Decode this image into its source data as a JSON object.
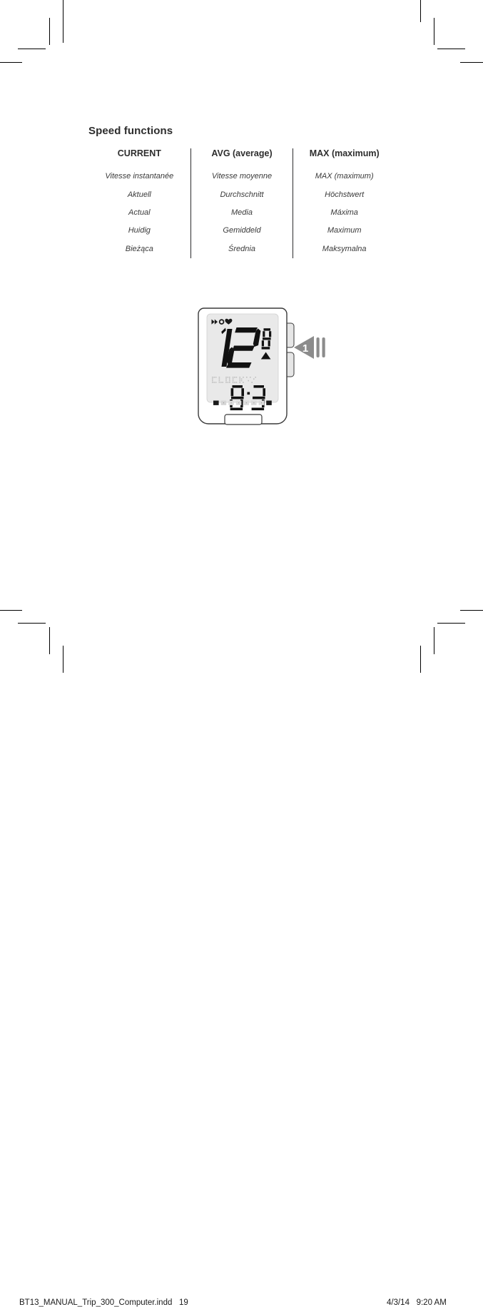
{
  "page": {
    "title": "Speed functions"
  },
  "table": {
    "columns": [
      {
        "header": "CURRENT",
        "items": [
          "Vitesse instantanée",
          "Aktuell",
          "Actual",
          "Huidig",
          "Bieżąca"
        ]
      },
      {
        "header": "AVG (average)",
        "items": [
          "Vitesse moyenne",
          "Durchschnitt",
          "Media",
          "Gemiddeld",
          "Średnia"
        ]
      },
      {
        "header": "MAX (maximum)",
        "items": [
          "MAX (maximum)",
          "Höchstwert",
          "Máxima",
          "Maximum",
          "Maksymalna"
        ]
      }
    ]
  },
  "device": {
    "name": "bike-computer",
    "icons": [
      "chevron-double-right-icon",
      "circle-icon",
      "heart-icon"
    ],
    "speed_value": "12",
    "speed_decimal": "8",
    "unit_arrow": "up-triangle",
    "matrix_label": "CLOCK",
    "clock_value": "8:35",
    "segment_bar_count": 8,
    "segment_bar_active": 1,
    "buttons": [
      "upper-side-button",
      "lower-side-button",
      "bottom-button"
    ],
    "colors": {
      "lcd_background": "#e9e9e9",
      "digit": "#111111",
      "matrix_dots": "#bfbfbf",
      "body_outline": "#333333",
      "callout": "#8c8c8c"
    }
  },
  "callout": {
    "label": "1",
    "shape": "left-triangle",
    "bars": 2
  },
  "footer": {
    "file_name": "BT13_MANUAL_Trip_300_Computer.indd",
    "page_number": "19",
    "date": "4/3/14",
    "time": "9:20 AM"
  }
}
